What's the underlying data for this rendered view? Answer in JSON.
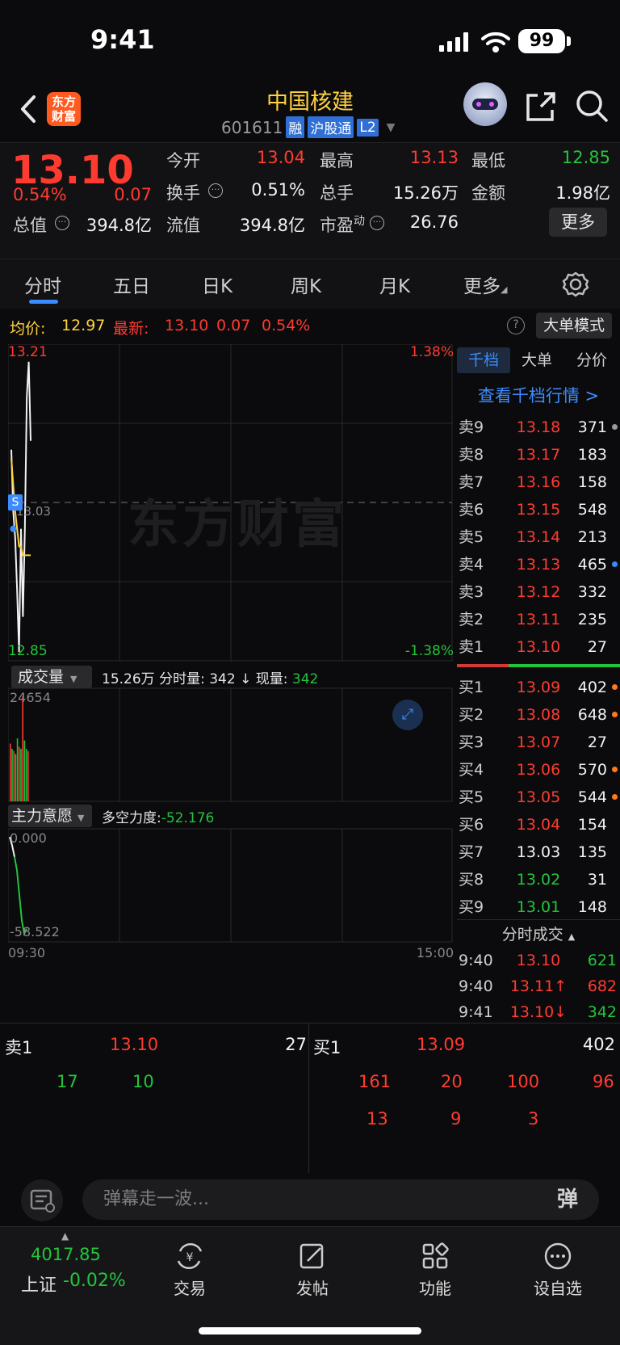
{
  "status_bar": {
    "time": "9:41",
    "battery": "99"
  },
  "header": {
    "title": "中国核建",
    "code": "601611",
    "tags": [
      "融",
      "沪股通",
      "L2"
    ],
    "logo_text": [
      "东方",
      "财富"
    ]
  },
  "quote": {
    "price": "13.10",
    "change_pct": "0.54%",
    "change": "0.07",
    "open_label": "今开",
    "open": "13.04",
    "high_label": "最高",
    "high": "13.13",
    "low_label": "最低",
    "low": "12.85",
    "turnover_label": "换手",
    "turnover": "0.51%",
    "volume_label": "总手",
    "volume": "15.26万",
    "amount_label": "金额",
    "amount": "1.98亿",
    "mktcap_label": "总值",
    "mktcap": "394.8亿",
    "float_label": "流值",
    "float": "394.8亿",
    "pe_label": "市盈",
    "pe_sup": "动",
    "pe": "26.76",
    "more_button": "更多"
  },
  "tabs": [
    "分时",
    "五日",
    "日K",
    "周K",
    "月K",
    "更多"
  ],
  "info_bar": {
    "avg_label": "均价:",
    "avg": "12.97",
    "latest_label": "最新:",
    "latest": "13.10",
    "latest_change": "0.07",
    "latest_pct": "0.54%",
    "big_order_button": "大单模式"
  },
  "chart_data": {
    "type": "line",
    "price_axis": {
      "top": "13.21",
      "mid": "13.03",
      "bottom": "12.85"
    },
    "pct_axis": {
      "top": "1.38%",
      "bottom": "-1.38%"
    },
    "watermark": "东方财富",
    "marker": "S",
    "series": [
      {
        "name": "price",
        "x": [
          0,
          1,
          2,
          3,
          4,
          5,
          6,
          7,
          8,
          9,
          10
        ],
        "values": [
          13.09,
          13.02,
          12.99,
          12.93,
          12.86,
          13.0,
          12.9,
          13.0,
          13.15,
          13.19,
          13.1
        ]
      },
      {
        "name": "avg",
        "x": [
          0,
          1,
          2,
          3,
          4,
          5,
          6,
          7,
          8,
          9,
          10
        ],
        "values": [
          13.08,
          13.05,
          13.02,
          13.0,
          12.98,
          12.98,
          12.97,
          12.97,
          12.97,
          12.97,
          12.97
        ]
      }
    ],
    "volume": {
      "label": "成交量",
      "total": "15.26万",
      "minute_label": "分时量:",
      "minute": "342",
      "now_label": "现量:",
      "now": "342",
      "max": "24654",
      "bars": [
        {
          "v": 0.55,
          "c": "red"
        },
        {
          "v": 0.5,
          "c": "green"
        },
        {
          "v": 0.48,
          "c": "red"
        },
        {
          "v": 0.45,
          "c": "green"
        },
        {
          "v": 0.6,
          "c": "green"
        },
        {
          "v": 0.52,
          "c": "red"
        },
        {
          "v": 0.5,
          "c": "green"
        },
        {
          "v": 1.0,
          "c": "red"
        },
        {
          "v": 0.58,
          "c": "green"
        },
        {
          "v": 0.5,
          "c": "green"
        },
        {
          "v": 0.48,
          "c": "red"
        }
      ]
    },
    "main_force": {
      "label": "主力意愿",
      "power_label": "多空力度:",
      "power": "-52.176",
      "top": "0.000",
      "bottom": "-58.522",
      "values": [
        0.0,
        -5,
        -12,
        -20,
        -35,
        -50,
        -58,
        -55
      ]
    },
    "time_axis": {
      "start": "09:30",
      "end": "15:00"
    }
  },
  "orderbook": {
    "tabs": [
      "千档",
      "大单",
      "分价"
    ],
    "link": "查看千档行情 >",
    "asks": [
      {
        "level": "卖9",
        "price": "13.18",
        "vol": "371",
        "dot": "#9a9a9a",
        "color": "red"
      },
      {
        "level": "卖8",
        "price": "13.17",
        "vol": "183",
        "dot": "",
        "color": "red"
      },
      {
        "level": "卖7",
        "price": "13.16",
        "vol": "158",
        "dot": "",
        "color": "red"
      },
      {
        "level": "卖6",
        "price": "13.15",
        "vol": "548",
        "dot": "",
        "color": "red"
      },
      {
        "level": "卖5",
        "price": "13.14",
        "vol": "213",
        "dot": "",
        "color": "red"
      },
      {
        "level": "卖4",
        "price": "13.13",
        "vol": "465",
        "dot": "#3c8cff",
        "color": "red"
      },
      {
        "level": "卖3",
        "price": "13.12",
        "vol": "332",
        "dot": "",
        "color": "red"
      },
      {
        "level": "卖2",
        "price": "13.11",
        "vol": "235",
        "dot": "",
        "color": "red"
      },
      {
        "level": "卖1",
        "price": "13.10",
        "vol": "27",
        "dot": "",
        "color": "red"
      }
    ],
    "bids": [
      {
        "level": "买1",
        "price": "13.09",
        "vol": "402",
        "dot": "#ff7a1a",
        "color": "red"
      },
      {
        "level": "买2",
        "price": "13.08",
        "vol": "648",
        "dot": "#ff7a1a",
        "color": "red"
      },
      {
        "level": "买3",
        "price": "13.07",
        "vol": "27",
        "dot": "",
        "color": "red"
      },
      {
        "level": "买4",
        "price": "13.06",
        "vol": "570",
        "dot": "#ff7a1a",
        "color": "red"
      },
      {
        "level": "买5",
        "price": "13.05",
        "vol": "544",
        "dot": "#ff7a1a",
        "color": "red"
      },
      {
        "level": "买6",
        "price": "13.04",
        "vol": "154",
        "dot": "",
        "color": "red"
      },
      {
        "level": "买7",
        "price": "13.03",
        "vol": "135",
        "dot": "",
        "color": "white"
      },
      {
        "level": "买8",
        "price": "13.02",
        "vol": "31",
        "dot": "",
        "color": "green"
      },
      {
        "level": "买9",
        "price": "13.01",
        "vol": "148",
        "dot": "",
        "color": "green"
      }
    ],
    "ticks_title": "分时成交",
    "ticks": [
      {
        "time": "9:40",
        "price": "13.10",
        "vol": "621",
        "arrow": "",
        "vcolor": "green"
      },
      {
        "time": "9:40",
        "price": "13.11↑",
        "vol": "682",
        "arrow": "",
        "vcolor": "red"
      },
      {
        "time": "9:41",
        "price": "13.10↓",
        "vol": "342",
        "arrow": "",
        "vcolor": "green"
      }
    ]
  },
  "levels": {
    "ask_label": "卖1",
    "ask_price": "13.10",
    "ask_vol": "27",
    "ask_queue": [
      "17",
      "10"
    ],
    "bid_label": "买1",
    "bid_price": "13.09",
    "bid_vol": "402",
    "bid_queue_row1": [
      "161",
      "20",
      "100",
      "96"
    ],
    "bid_queue_row2": [
      "13",
      "9",
      "3"
    ]
  },
  "comment": {
    "placeholder": "弹幕走一波...",
    "danmu_button": "弹"
  },
  "nav": {
    "index_value": "4017.85",
    "index_name": "上证",
    "index_change": "-0.02%",
    "items": [
      "交易",
      "发帖",
      "功能",
      "设自选"
    ]
  },
  "colors": {
    "up": "#ff3b30",
    "down": "#23c43b",
    "accent": "#3c8cff",
    "title": "#ffd23f"
  }
}
